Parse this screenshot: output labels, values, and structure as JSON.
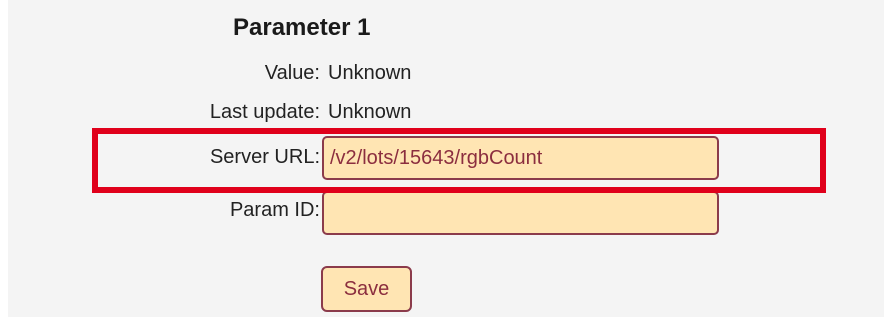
{
  "form": {
    "title": "Parameter 1",
    "value_label": "Value:",
    "value_text": "Unknown",
    "last_update_label": "Last update:",
    "last_update_text": "Unknown",
    "server_url_label": "Server URL:",
    "server_url_value": "/v2/lots/15643/rgbCount",
    "param_id_label": "Param ID:",
    "param_id_value": "",
    "save_label": "Save"
  },
  "colors": {
    "panel_background": "#f4f4f4",
    "input_background": "#ffe5b3",
    "input_border": "#8b3b4b",
    "input_text": "#8b2e3f",
    "highlight_border": "#e0001b"
  }
}
